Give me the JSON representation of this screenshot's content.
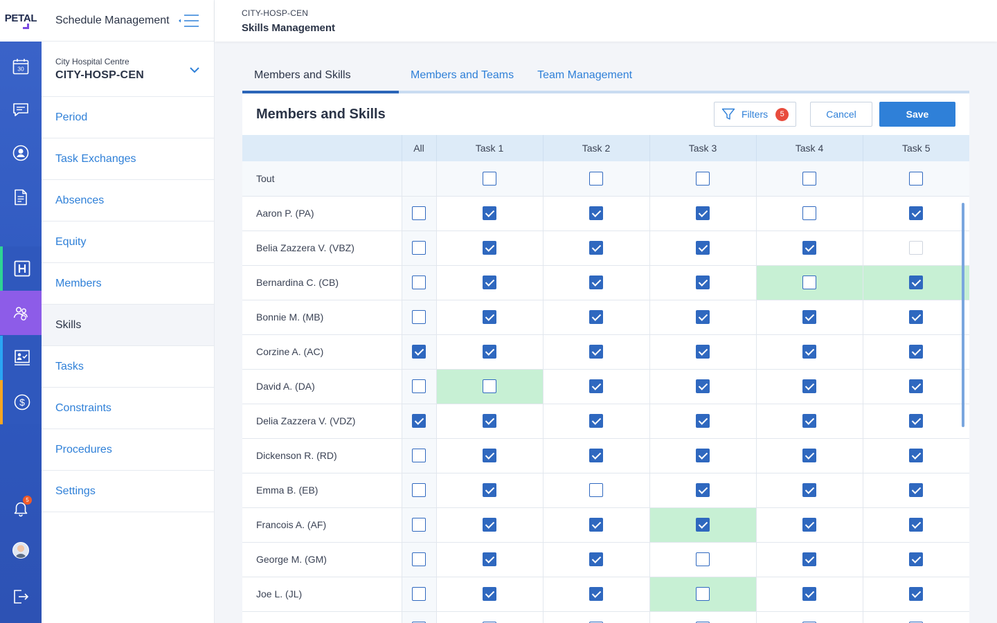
{
  "logo": {
    "text": "PETAL"
  },
  "rail": {
    "items": [
      {
        "name": "calendar-icon",
        "label": "30"
      },
      {
        "name": "chat-icon"
      },
      {
        "name": "user-circle-icon"
      },
      {
        "name": "document-icon"
      },
      {
        "name": "hospital-icon"
      },
      {
        "name": "team-icon"
      },
      {
        "name": "presentation-icon"
      },
      {
        "name": "dollar-icon"
      }
    ],
    "notifications": {
      "count": "5"
    },
    "accent_colors": {
      "green": "#2ed394",
      "purple": "#8d5ce8",
      "blue": "#2aa6f4",
      "orange": "#f5a623"
    }
  },
  "sidebar": {
    "title": "Schedule Management",
    "org": {
      "name": "City Hospital Centre",
      "code": "CITY-HOSP-CEN"
    },
    "items": [
      {
        "label": "Period"
      },
      {
        "label": "Task Exchanges"
      },
      {
        "label": "Absences"
      },
      {
        "label": "Equity"
      },
      {
        "label": "Members"
      },
      {
        "label": "Skills"
      },
      {
        "label": "Tasks"
      },
      {
        "label": "Constraints"
      },
      {
        "label": "Procedures"
      },
      {
        "label": "Settings"
      }
    ],
    "active_item": "Skills"
  },
  "header": {
    "breadcrumb": "CITY-HOSP-CEN",
    "title": "Skills Management"
  },
  "tabs": [
    {
      "label": "Members and Skills",
      "active": true
    },
    {
      "label": "Members and Teams",
      "active": false
    },
    {
      "label": "Team Management",
      "active": false
    }
  ],
  "card": {
    "title": "Members and Skills",
    "filters_label": "Filters",
    "filters_count": "5",
    "cancel_label": "Cancel",
    "save_label": "Save"
  },
  "grid": {
    "columns": [
      "All",
      "Task 1",
      "Task 2",
      "Task 3",
      "Task 4",
      "Task 5"
    ],
    "all_row_label": "Tout",
    "rows": [
      {
        "name": "Aaron P. (PA)",
        "all": false,
        "tasks": [
          true,
          true,
          true,
          false,
          true
        ],
        "changed": []
      },
      {
        "name": "Belia Zazzera V. (VBZ)",
        "all": false,
        "tasks": [
          true,
          true,
          true,
          true,
          false
        ],
        "changed": [],
        "faint": [
          4
        ]
      },
      {
        "name": "Bernardina C. (CB)",
        "all": false,
        "tasks": [
          true,
          true,
          true,
          false,
          true
        ],
        "changed": [
          3,
          4
        ]
      },
      {
        "name": "Bonnie M. (MB)",
        "all": false,
        "tasks": [
          true,
          true,
          true,
          true,
          true
        ],
        "changed": []
      },
      {
        "name": "Corzine A. (AC)",
        "all": true,
        "tasks": [
          true,
          true,
          true,
          true,
          true
        ],
        "changed": []
      },
      {
        "name": "David A. (DA)",
        "all": false,
        "tasks": [
          false,
          true,
          true,
          true,
          true
        ],
        "changed": [
          0
        ]
      },
      {
        "name": "Delia Zazzera V. (VDZ)",
        "all": true,
        "tasks": [
          true,
          true,
          true,
          true,
          true
        ],
        "changed": []
      },
      {
        "name": "Dickenson R. (RD)",
        "all": false,
        "tasks": [
          true,
          true,
          true,
          true,
          true
        ],
        "changed": []
      },
      {
        "name": "Emma B. (EB)",
        "all": false,
        "tasks": [
          true,
          false,
          true,
          true,
          true
        ],
        "changed": []
      },
      {
        "name": "Francois A. (AF)",
        "all": false,
        "tasks": [
          true,
          true,
          true,
          true,
          true
        ],
        "changed": [
          2
        ]
      },
      {
        "name": "George M. (GM)",
        "all": false,
        "tasks": [
          true,
          true,
          false,
          true,
          true
        ],
        "changed": []
      },
      {
        "name": "Joe L. (JL)",
        "all": false,
        "tasks": [
          true,
          true,
          false,
          true,
          true
        ],
        "changed": [
          2
        ]
      },
      {
        "name": "",
        "all": false,
        "tasks": [
          false,
          false,
          false,
          false,
          false
        ],
        "changed": []
      }
    ]
  },
  "colors": {
    "accent": "#2f80d8",
    "checkbox": "#2f68bf",
    "changed_cell": "#c7f0d4",
    "header_row": "#ddebf8"
  }
}
